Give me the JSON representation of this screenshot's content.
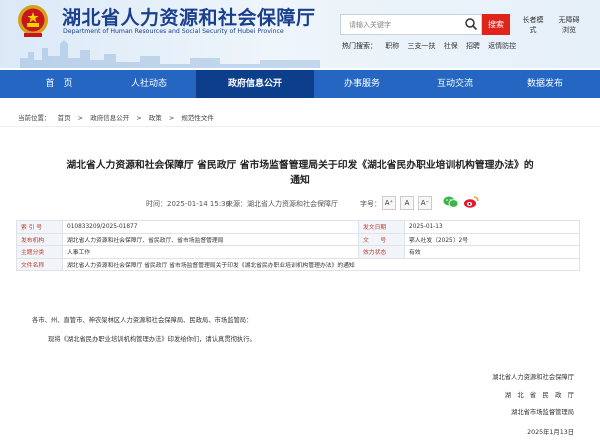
{
  "header": {
    "site_title": "湖北省人力资源和社会保障厅",
    "site_title_en": "Department of Human Resources and Social Security of Hubei Province",
    "search_placeholder": "请输入关键字",
    "search_button": "搜索",
    "hot_label": "热门搜索：",
    "hot_terms": [
      "职称",
      "三支一扶",
      "社保",
      "招聘",
      "返情防控"
    ],
    "elder_mode": "长者模式",
    "accessibility": "无障碍浏览"
  },
  "nav": {
    "items": [
      "首　页",
      "人社动态",
      "政府信息公开",
      "办事服务",
      "互动交流",
      "数据发布"
    ],
    "active_index": 2
  },
  "breadcrumb": {
    "prefix": "当前位置：",
    "items": [
      "首页",
      ">",
      "政府信息公开",
      ">",
      "政策",
      ">",
      "规范性文件"
    ]
  },
  "article": {
    "title_line1": "湖北省人力资源和社会保障厅 省民政厅 省市场监督管理局关于印发《湖北省民办职业培训机构管理办法》的",
    "title_line2": "通知",
    "date": "时间：2025-01-14 15:30",
    "source": "来源：湖北省人力资源和社会保障厅",
    "font_size_label": "字号：",
    "font_sizes": [
      "A⁺",
      "A",
      "A⁻"
    ]
  },
  "info_table": {
    "rows": [
      {
        "k1": "索 引 号",
        "v1": "010833209/2025-01877",
        "k2": "发文日期",
        "v2": "2025-01-13"
      },
      {
        "k1": "发布机构",
        "v1": "湖北省人力资源和社会保障厅、省民政厅、省市场监督管理局",
        "k2": "文　　号",
        "v2": "鄂人社发〔2025〕2号"
      },
      {
        "k1": "主题分类",
        "v1": "人事工作",
        "k2": "效力状态",
        "v2": "有效"
      },
      {
        "k1": "文件名称",
        "v1": "湖北省人力资源和社会保障厅 省民政厅 省市场监督管理局关于印发《湖北省民办职业培训机构管理办法》的通知",
        "k2": "",
        "v2": ""
      }
    ]
  },
  "body": {
    "salutation": "各市、州、直管市、神农架林区人力资源和社会保障局、民政局、市场监管局：",
    "paragraph": "现将《湖北省民办职业培训机构管理办法》印发给你们，请认真贯彻执行。",
    "signers": [
      "湖北省人力资源和社会保障厅",
      "湖　北　省　民　政　厅",
      "湖北省市场监督管理局"
    ],
    "sign_date": "2025年1月13日"
  },
  "colors": {
    "nav_bg": "#2466c1",
    "nav_active": "#0d3e8c",
    "brand_blue": "#1a3f8f",
    "search_red": "#e0231b"
  }
}
